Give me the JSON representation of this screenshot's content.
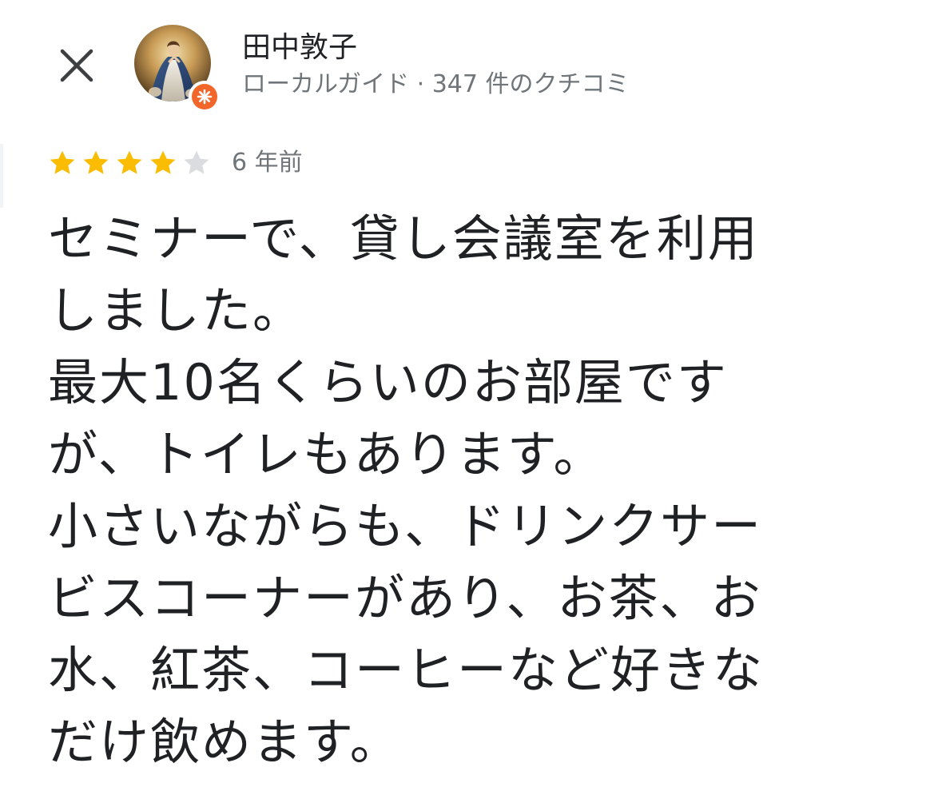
{
  "header": {
    "user_name": "田中敦子",
    "user_meta": "ローカルガイド · 347 件のクチコミ",
    "close_icon": "close-icon",
    "avatar_icon": "avatar",
    "badge_icon": "local-guide-badge-icon",
    "colors": {
      "badge": "#f2662a"
    }
  },
  "review": {
    "rating": 4,
    "max_rating": 5,
    "posted": "6 年前",
    "star_colors": {
      "filled": "#fbbc04",
      "empty": "#dadce0"
    },
    "text_lines": [
      "セミナーで、貸し会議室を利用",
      "しました。",
      "最大10名くらいのお部屋です",
      "が、トイレもあります。",
      "小さいながらも、ドリンクサー",
      "ビスコーナーがあり、お茶、お",
      "水、紅茶、コーヒーなど好きな",
      "だけ飲めます。"
    ]
  }
}
